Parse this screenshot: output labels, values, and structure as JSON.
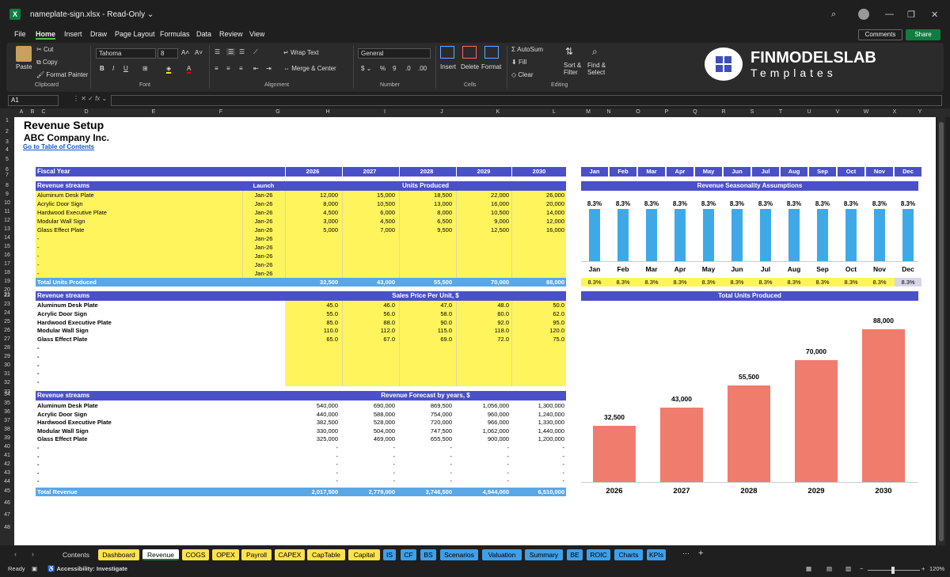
{
  "window": {
    "filename": "nameplate-sign.xlsx",
    "mode": "Read-Only"
  },
  "menu": [
    "File",
    "Home",
    "Insert",
    "Draw",
    "Page Layout",
    "Formulas",
    "Data",
    "Review",
    "View"
  ],
  "top_buttons": {
    "comments": "Comments",
    "share": "Share"
  },
  "ribbon": {
    "paste": "Paste",
    "cut": "Cut",
    "copy": "Copy",
    "format_painter": "Format Painter",
    "clipboard": "Clipboard",
    "font_name": "Tahoma",
    "font_size": "8",
    "font_group": "Font",
    "wrap_text": "Wrap Text",
    "merge_center": "Merge & Center",
    "alignment": "Alignment",
    "number_format": "General",
    "number_group": "Number",
    "insert": "Insert",
    "delete": "Delete",
    "format": "Format",
    "cells": "Cells",
    "autosum": "AutoSum",
    "fill": "Fill",
    "clear": "Clear",
    "sort_filter": "Sort & Filter",
    "find_select": "Find & Select",
    "editing": "Editing"
  },
  "brand": {
    "title": "FINMODELSLAB",
    "subtitle": "Templates"
  },
  "namebox": "A1",
  "columns": [
    "A",
    "B",
    "C",
    "D",
    "E",
    "F",
    "G",
    "H",
    "I",
    "J",
    "K",
    "L",
    "M",
    "N",
    "O",
    "P",
    "Q",
    "R",
    "S",
    "T",
    "U",
    "V",
    "W",
    "X",
    "Y"
  ],
  "rows": [
    "1",
    "2",
    "3",
    "4",
    "5",
    "6",
    "7",
    "8",
    "9",
    "10",
    "11",
    "12",
    "13",
    "14",
    "15",
    "16",
    "17",
    "18",
    "19",
    "20",
    "21",
    "22",
    "23",
    "24",
    "25",
    "26",
    "27",
    "28",
    "29",
    "30",
    "31",
    "32",
    "33",
    "34",
    "35",
    "36",
    "37",
    "38",
    "39",
    "40",
    "41",
    "42",
    "43",
    "44",
    "45",
    "46",
    "47",
    "48"
  ],
  "sheet": {
    "title": "Revenue Setup",
    "company": "ABC Company Inc.",
    "link": "Go to Table of Contents",
    "fiscal_year_label": "Fiscal Year",
    "years": [
      "2026",
      "2027",
      "2028",
      "2029",
      "2030"
    ],
    "months": [
      "Jan",
      "Feb",
      "Mar",
      "Apr",
      "May",
      "Jun",
      "Jul",
      "Aug",
      "Sep",
      "Oct",
      "Nov",
      "Dec"
    ],
    "revenue_streams_label": "Revenue streams",
    "launch_label": "Launch",
    "units_header": "Units Produced",
    "units_rows": [
      {
        "name": "Aluminum Desk Plate",
        "launch": "Jan-26",
        "values": [
          "12,000",
          "15,000",
          "18,500",
          "22,000",
          "26,000"
        ]
      },
      {
        "name": "Acrylic Door Sign",
        "launch": "Jan-26",
        "values": [
          "8,000",
          "10,500",
          "13,000",
          "16,000",
          "20,000"
        ]
      },
      {
        "name": "Hardwood Executive Plate",
        "launch": "Jan-26",
        "values": [
          "4,500",
          "6,000",
          "8,000",
          "10,500",
          "14,000"
        ]
      },
      {
        "name": "Modular Wall Sign",
        "launch": "Jan-26",
        "values": [
          "3,000",
          "4,500",
          "6,500",
          "9,000",
          "12,000"
        ]
      },
      {
        "name": "Glass Effect Plate",
        "launch": "Jan-26",
        "values": [
          "5,000",
          "7,000",
          "9,500",
          "12,500",
          "16,000"
        ]
      },
      {
        "name": "-",
        "launch": "Jan-26",
        "values": [
          "",
          "",
          "",
          "",
          ""
        ]
      },
      {
        "name": "-",
        "launch": "Jan-26",
        "values": [
          "",
          "",
          "",
          "",
          ""
        ]
      },
      {
        "name": "-",
        "launch": "Jan-26",
        "values": [
          "",
          "",
          "",
          "",
          ""
        ]
      },
      {
        "name": "-",
        "launch": "Jan-26",
        "values": [
          "",
          "",
          "",
          "",
          ""
        ]
      },
      {
        "name": "-",
        "launch": "Jan-26",
        "values": [
          "",
          "",
          "",
          "",
          ""
        ]
      }
    ],
    "total_units_label": "Total Units Produced",
    "total_units": [
      "32,500",
      "43,000",
      "55,500",
      "70,000",
      "88,000"
    ],
    "price_header": "Sales Price Per Unit, $",
    "price_rows": [
      {
        "name": "Aluminum Desk Plate",
        "values": [
          "45.0",
          "46.0",
          "47.0",
          "48.0",
          "50.0"
        ]
      },
      {
        "name": "Acrylic Door Sign",
        "values": [
          "55.0",
          "56.0",
          "58.0",
          "60.0",
          "62.0"
        ]
      },
      {
        "name": "Hardwood Executive Plate",
        "values": [
          "85.0",
          "88.0",
          "90.0",
          "92.0",
          "95.0"
        ]
      },
      {
        "name": "Modular Wall Sign",
        "values": [
          "110.0",
          "112.0",
          "115.0",
          "118.0",
          "120.0"
        ]
      },
      {
        "name": "Glass Effect Plate",
        "values": [
          "65.0",
          "67.0",
          "69.0",
          "72.0",
          "75.0"
        ]
      },
      {
        "name": "-",
        "values": [
          "",
          "",
          "",
          "",
          ""
        ]
      },
      {
        "name": "-",
        "values": [
          "",
          "",
          "",
          "",
          ""
        ]
      },
      {
        "name": "-",
        "values": [
          "",
          "",
          "",
          "",
          ""
        ]
      },
      {
        "name": "-",
        "values": [
          "",
          "",
          "",
          "",
          ""
        ]
      },
      {
        "name": "-",
        "values": [
          "",
          "",
          "",
          "",
          ""
        ]
      }
    ],
    "forecast_header": "Revenue Forecast by years, $",
    "forecast_rows": [
      {
        "name": "Aluminum Desk Plate",
        "values": [
          "540,000",
          "690,000",
          "869,500",
          "1,056,000",
          "1,300,000"
        ]
      },
      {
        "name": "Acrylic Door Sign",
        "values": [
          "440,000",
          "588,000",
          "754,000",
          "960,000",
          "1,240,000"
        ]
      },
      {
        "name": "Hardwood Executive Plate",
        "values": [
          "382,500",
          "528,000",
          "720,000",
          "966,000",
          "1,330,000"
        ]
      },
      {
        "name": "Modular Wall Sign",
        "values": [
          "330,000",
          "504,000",
          "747,500",
          "1,062,000",
          "1,440,000"
        ]
      },
      {
        "name": "Glass Effect Plate",
        "values": [
          "325,000",
          "469,000",
          "655,500",
          "900,000",
          "1,200,000"
        ]
      },
      {
        "name": "-",
        "values": [
          "-",
          "-",
          "-",
          "-",
          "-"
        ]
      },
      {
        "name": "-",
        "values": [
          "-",
          "-",
          "-",
          "-",
          "-"
        ]
      },
      {
        "name": "-",
        "values": [
          "-",
          "-",
          "-",
          "-",
          "-"
        ]
      },
      {
        "name": "-",
        "values": [
          "-",
          "-",
          "-",
          "-",
          "-"
        ]
      },
      {
        "name": "-",
        "values": [
          "-",
          "-",
          "-",
          "-",
          "-"
        ]
      }
    ],
    "total_revenue_label": "Total Revenue",
    "total_revenue": [
      "2,017,500",
      "2,779,000",
      "3,746,500",
      "4,944,000",
      "6,510,000"
    ],
    "seasonality_header": "Revenue Seasonality Assumptions",
    "seasonality_values": [
      "8.3%",
      "8.3%",
      "8.3%",
      "8.3%",
      "8.3%",
      "8.3%",
      "8.3%",
      "8.3%",
      "8.3%",
      "8.3%",
      "8.3%",
      "8.3%"
    ],
    "total_units_chart_header": "Total Units Produced"
  },
  "chart_data": [
    {
      "type": "bar",
      "title": "Revenue Seasonality Assumptions",
      "categories": [
        "Jan",
        "Feb",
        "Mar",
        "Apr",
        "May",
        "Jun",
        "Jul",
        "Aug",
        "Sep",
        "Oct",
        "Nov",
        "Dec"
      ],
      "values": [
        8.3,
        8.3,
        8.3,
        8.3,
        8.3,
        8.3,
        8.3,
        8.3,
        8.3,
        8.3,
        8.3,
        8.3
      ],
      "data_labels": [
        "8.3%",
        "8.3%",
        "8.3%",
        "8.3%",
        "8.3%",
        "8.3%",
        "8.3%",
        "8.3%",
        "8.3%",
        "8.3%",
        "8.3%",
        "8.3%"
      ],
      "color": "#3fa9e8"
    },
    {
      "type": "bar",
      "title": "Total Units Produced",
      "categories": [
        "2026",
        "2027",
        "2028",
        "2029",
        "2030"
      ],
      "values": [
        32500,
        43000,
        55500,
        70000,
        88000
      ],
      "data_labels": [
        "32,500",
        "43,000",
        "55,500",
        "70,000",
        "88,000"
      ],
      "ylim": [
        0,
        88000
      ],
      "color": "#f07c6e"
    }
  ],
  "tabs": [
    {
      "label": "Contents",
      "style": "plain"
    },
    {
      "label": "Dashboard",
      "style": "y"
    },
    {
      "label": "Revenue",
      "style": "active"
    },
    {
      "label": "COGS",
      "style": "y"
    },
    {
      "label": "OPEX",
      "style": "y"
    },
    {
      "label": "Payroll",
      "style": "y"
    },
    {
      "label": "CAPEX",
      "style": "y"
    },
    {
      "label": "CapTable",
      "style": "y"
    },
    {
      "label": "Capital",
      "style": "y"
    },
    {
      "label": "IS",
      "style": "b"
    },
    {
      "label": "CF",
      "style": "b"
    },
    {
      "label": "BS",
      "style": "b"
    },
    {
      "label": "Scenarios",
      "style": "b"
    },
    {
      "label": "Valuation",
      "style": "b"
    },
    {
      "label": "Summary",
      "style": "b"
    },
    {
      "label": "BE",
      "style": "b"
    },
    {
      "label": "ROIC",
      "style": "b"
    },
    {
      "label": "Charts",
      "style": "b"
    },
    {
      "label": "KPIs",
      "style": "b"
    }
  ],
  "status": {
    "ready": "Ready",
    "accessibility": "Accessibility: Investigate",
    "zoom": "120%"
  },
  "colors": {
    "header_blue": "#4a50c8",
    "yellow": "#fff45c",
    "light_blue": "#5aa7e6",
    "bar_blue": "#3fa9e8",
    "bar_red": "#f07c6e"
  }
}
